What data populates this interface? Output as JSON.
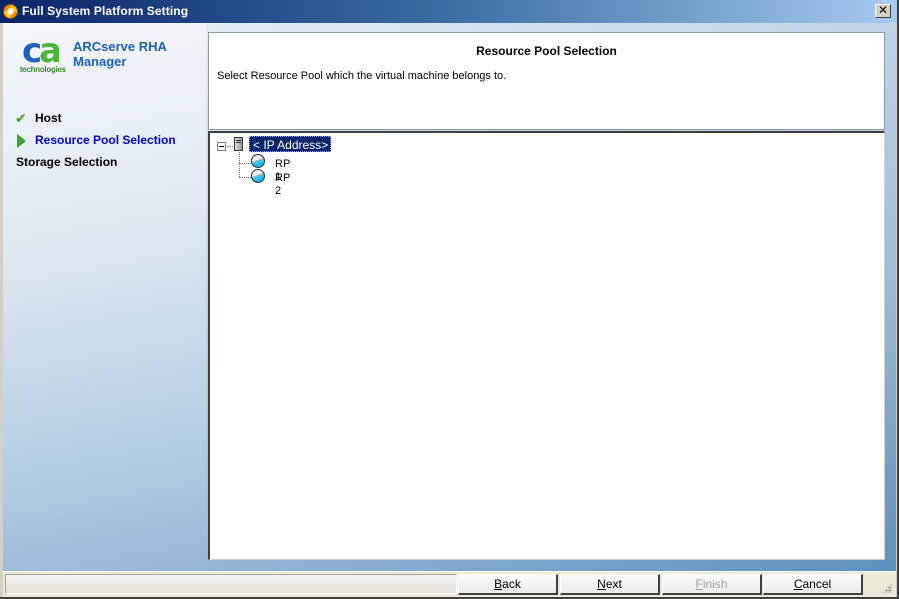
{
  "window": {
    "title": "Full System Platform Setting",
    "close_label": "✕"
  },
  "branding": {
    "logo_mark": "ca",
    "logo_sub": "technologies",
    "app_name_line1": "ARCserve RHA",
    "app_name_line2": "Manager"
  },
  "steps": [
    {
      "label": "Host",
      "state": "completed",
      "icon": "check-icon"
    },
    {
      "label": "Resource Pool Selection",
      "state": "current",
      "icon": "arrow-right-icon"
    },
    {
      "label": "Storage Selection",
      "state": "pending",
      "icon": ""
    }
  ],
  "header": {
    "title": "Resource Pool Selection",
    "description": "Select Resource Pool which the virtual machine belongs to."
  },
  "tree": {
    "root": {
      "label": "< IP Address>",
      "expanded": true,
      "selected": true
    },
    "children": [
      {
        "label": "RP 1"
      },
      {
        "label": "RP 2"
      }
    ]
  },
  "status": {
    "text": ""
  },
  "buttons": {
    "back": {
      "pre": "",
      "accel": "B",
      "post": "ack",
      "enabled": true
    },
    "next": {
      "pre": "",
      "accel": "N",
      "post": "ext",
      "enabled": true
    },
    "finish": {
      "pre": "",
      "accel": "F",
      "post": "inish",
      "enabled": false
    },
    "cancel": {
      "pre": "",
      "accel": "C",
      "post": "ancel",
      "enabled": true
    }
  }
}
